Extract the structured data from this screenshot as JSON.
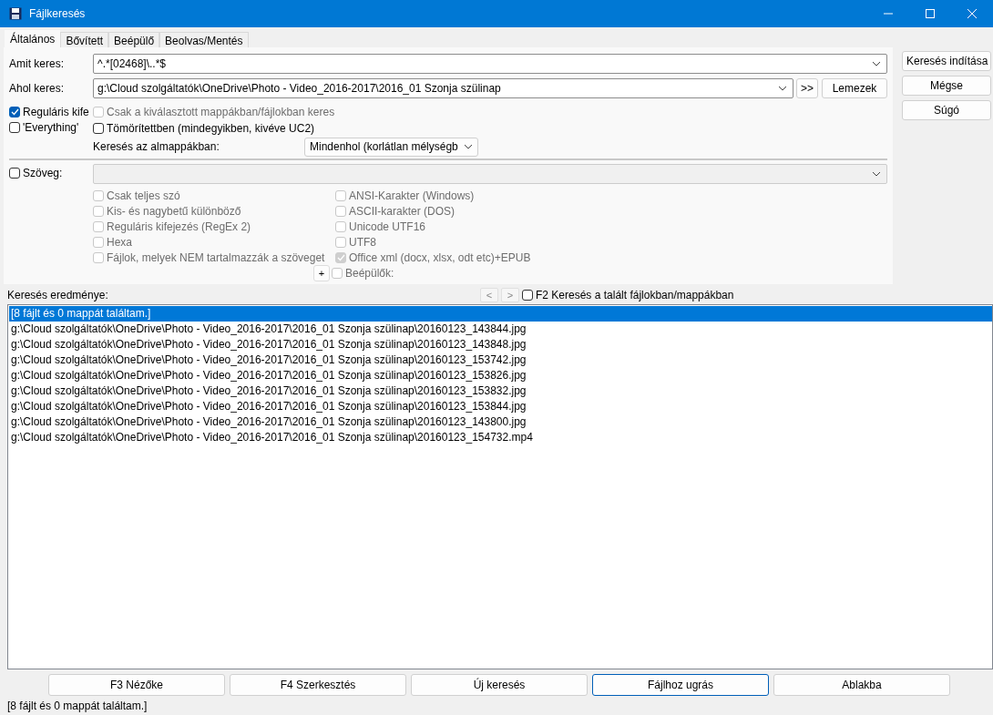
{
  "window": {
    "title": "Fájlkeresés"
  },
  "tabs": [
    {
      "label": "Általános",
      "selected": true
    },
    {
      "label": "Bővített",
      "selected": false
    },
    {
      "label": "Beépülő",
      "selected": false
    },
    {
      "label": "Beolvas/Mentés",
      "selected": false
    }
  ],
  "search_for": {
    "label": "Amit keres:",
    "value": "^.*[02468]\\..*$"
  },
  "search_in": {
    "label": "Ahol keres:",
    "value": "g:\\Cloud szolgáltatók\\OneDrive\\Photo - Video_2016-2017\\2016_01 Szonja szülinap",
    "browse_button": ">>",
    "drives_button": "Lemezek"
  },
  "options": [
    {
      "label": "Reguláris kife",
      "checked": true,
      "disabled": false
    },
    {
      "label": "Csak a kiválasztott mappákban/fájlokban keres",
      "checked": false,
      "disabled": true
    },
    {
      "label": "'Everything'",
      "checked": false,
      "disabled": false
    },
    {
      "label": "Tömörítettben (mindegyikben, kivéve UC2)",
      "checked": false,
      "disabled": false
    }
  ],
  "subfolders": {
    "label": "Keresés az almappákban:",
    "value": "Mindenhol (korlátlan mélységb"
  },
  "text_search": {
    "label": "Szöveg:",
    "checked": false,
    "field_disabled": true
  },
  "text_options_left": [
    {
      "label": "Csak teljes szó",
      "checked": false,
      "disabled": true
    },
    {
      "label": "Kis- és nagybetű különböző",
      "checked": false,
      "disabled": true
    },
    {
      "label": "Reguláris kifejezés (RegEx 2)",
      "checked": false,
      "disabled": true
    },
    {
      "label": "Hexa",
      "checked": false,
      "disabled": true
    },
    {
      "label": "Fájlok, melyek NEM tartalmazzák a szöveget",
      "checked": false,
      "disabled": true
    }
  ],
  "text_options_right": [
    {
      "label": "ANSI-Karakter (Windows)",
      "checked": false,
      "disabled": true
    },
    {
      "label": "ASCII-karakter (DOS)",
      "checked": false,
      "disabled": true
    },
    {
      "label": "Unicode UTF16",
      "checked": false,
      "disabled": true
    },
    {
      "label": "UTF8",
      "checked": false,
      "disabled": true
    },
    {
      "label": "Office xml (docx, xlsx, odt etc)+EPUB",
      "checked": true,
      "disabled": true
    },
    {
      "label": "Beépülők:",
      "checked": false,
      "disabled": true
    }
  ],
  "plus_button": "+",
  "side_buttons": [
    "Keresés indítása",
    "Mégse",
    "Súgó"
  ],
  "results": {
    "label": "Keresés eredménye:",
    "prev_button": "<",
    "next_button": ">",
    "f2_option": {
      "label": "F2 Keresés a talált fájlokban/mappákban",
      "checked": false
    },
    "rows": [
      {
        "text": "[8 fájlt és 0 mappát találtam.]",
        "selected": true
      },
      {
        "text": "g:\\Cloud szolgáltatók\\OneDrive\\Photo - Video_2016-2017\\2016_01 Szonja szülinap\\20160123_143844.jpg",
        "selected": false
      },
      {
        "text": "g:\\Cloud szolgáltatók\\OneDrive\\Photo - Video_2016-2017\\2016_01 Szonja szülinap\\20160123_143848.jpg",
        "selected": false
      },
      {
        "text": "g:\\Cloud szolgáltatók\\OneDrive\\Photo - Video_2016-2017\\2016_01 Szonja szülinap\\20160123_153742.jpg",
        "selected": false
      },
      {
        "text": "g:\\Cloud szolgáltatók\\OneDrive\\Photo - Video_2016-2017\\2016_01 Szonja szülinap\\20160123_153826.jpg",
        "selected": false
      },
      {
        "text": "g:\\Cloud szolgáltatók\\OneDrive\\Photo - Video_2016-2017\\2016_01 Szonja szülinap\\20160123_153832.jpg",
        "selected": false
      },
      {
        "text": "g:\\Cloud szolgáltatók\\OneDrive\\Photo - Video_2016-2017\\2016_01 Szonja szülinap\\20160123_153844.jpg",
        "selected": false
      },
      {
        "text": "g:\\Cloud szolgáltatók\\OneDrive\\Photo - Video_2016-2017\\2016_01 Szonja szülinap\\20160123_143800.jpg",
        "selected": false
      },
      {
        "text": "g:\\Cloud szolgáltatók\\OneDrive\\Photo - Video_2016-2017\\2016_01 Szonja szülinap\\20160123_154732.mp4",
        "selected": false
      }
    ]
  },
  "bottom_buttons": [
    {
      "label": "F3 Nézőke",
      "focused": false
    },
    {
      "label": "F4 Szerkesztés",
      "focused": false
    },
    {
      "label": "Új keresés",
      "focused": false
    },
    {
      "label": "Fájlhoz ugrás",
      "focused": true
    },
    {
      "label": "Ablakba",
      "focused": false
    }
  ],
  "status_bar": "[8 fájlt és 0 mappát találtam.]"
}
